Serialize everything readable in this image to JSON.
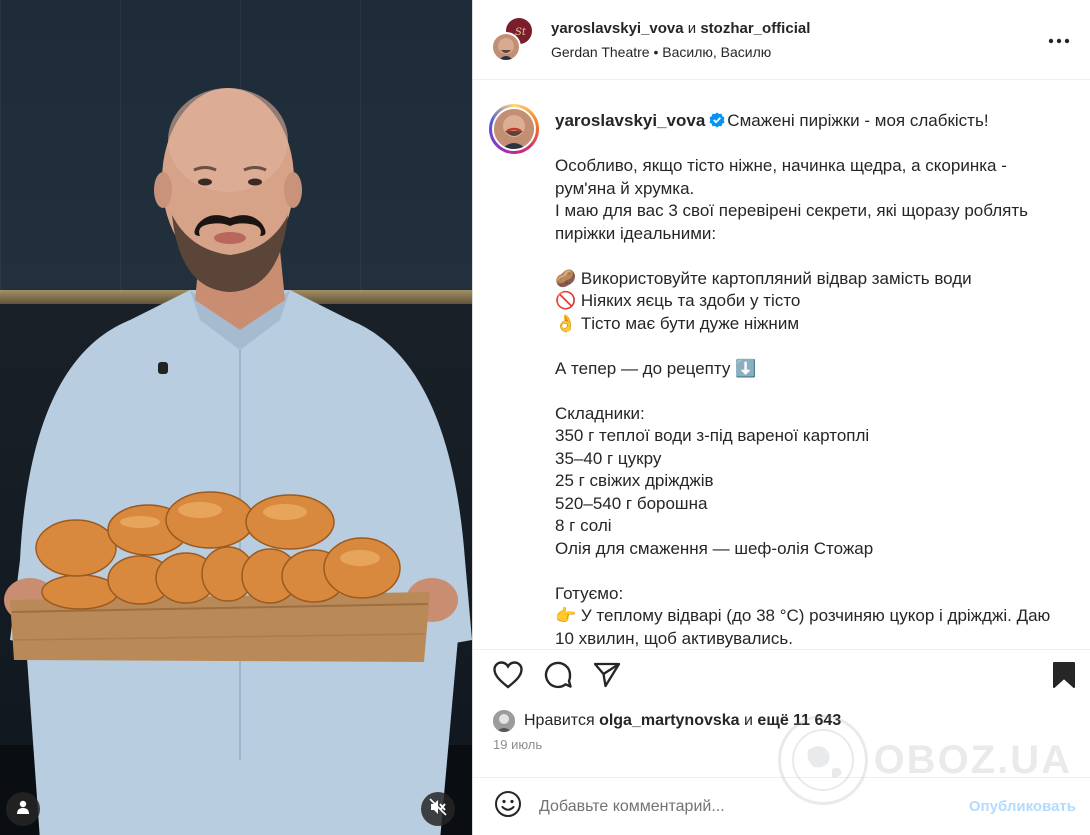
{
  "header": {
    "user1": "yaroslavskyi_vova",
    "and_word": "и",
    "user2": "stozhar_official",
    "location": "Gerdan Theatre • Василю, Василю"
  },
  "caption": {
    "username": "yaroslavskyi_vova",
    "headline": "Смажені пиріжки - моя слабкість!",
    "lines": [
      "",
      "Особливо, якщо тісто ніжне, начинка щедра, а скоринка -",
      "рум'яна й хрумка.",
      "І маю для вас 3 свої перевірені секрети, які щоразу роблять",
      "пиріжки ідеальними:",
      "",
      "🥔 Використовуйте картопляний відвар замість води",
      "🚫 Ніяких яєць та здоби у тісто",
      "👌 Тісто має бути дуже ніжним",
      "",
      "А тепер — до рецепту ⬇️",
      "",
      "Складники:",
      "350 г теплої води з-під вареної картоплі",
      "35–40 г цукру",
      "25 г свіжих дріжджів",
      "520–540 г борошна",
      "8 г солі",
      "Олія для смаження — шеф-олія Стожар",
      "",
      "Готуємо:",
      "👉 У теплому відварі (до 38 °С) розчиняю цукор і дріжджі. Даю",
      "10 хвилин, щоб активувались."
    ]
  },
  "likes": {
    "prefix": "Нравится",
    "user": "olga_martynovska",
    "middle": "и",
    "count": "ещё 11 643"
  },
  "date": "19 июль",
  "comment": {
    "placeholder": "Добавьте комментарий...",
    "publish": "Опубликовать"
  },
  "watermark": "OBOZ.UA",
  "colors": {
    "accent": "#0095f6",
    "publish_disabled": "#b3dbff",
    "verified": "#0095f6"
  },
  "icons": [
    "user-tag-icon",
    "muted-audio-icon",
    "more-options-icon",
    "verified-badge-icon",
    "like-heart-icon",
    "comment-icon",
    "share-icon",
    "save-bookmark-icon",
    "emoji-icon"
  ]
}
